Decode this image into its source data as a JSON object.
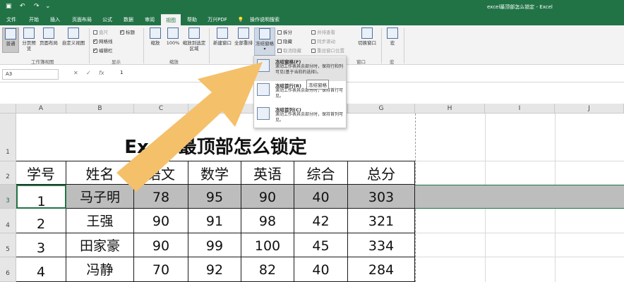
{
  "app": {
    "window_title": "excel最顶部怎么锁定 - Excel"
  },
  "menu_tabs": [
    "文件",
    "开始",
    "插入",
    "页面布局",
    "公式",
    "数据",
    "审阅",
    "视图",
    "帮助",
    "万兴PDF",
    "操作说明搜索"
  ],
  "ribbon": {
    "workbook_views": [
      "普通",
      "分页预览",
      "页面布局",
      "自定义视图"
    ],
    "workbook_views_group": "工作簿视图",
    "show_items": [
      {
        "label": "直尺",
        "checked": false,
        "enabled": false
      },
      {
        "label": "网格线",
        "checked": true,
        "enabled": true
      },
      {
        "label": "编辑栏",
        "checked": true,
        "enabled": true
      },
      {
        "label": "标题",
        "checked": true,
        "enabled": true
      }
    ],
    "show_group": "显示",
    "zoom_items": [
      "缩放",
      "100%",
      "缩放到选定区域"
    ],
    "zoom_group": "缩放",
    "window_items": [
      "新建窗口",
      "全部重排",
      "冻结窗格"
    ],
    "window_small": [
      "拆分",
      "隐藏",
      "取消隐藏"
    ],
    "window_small_dim": [
      "并排查看",
      "同步滚动",
      "重设窗口位置"
    ],
    "switch_window": "切换窗口",
    "window_group": "窗口",
    "macro": "宏",
    "macro_group": "宏"
  },
  "formula_bar": {
    "name_box": "A3",
    "fx": "fx",
    "value": "1"
  },
  "freeze_menu": {
    "items": [
      {
        "title": "冻结窗格(F)",
        "desc": "滚动工作表其余部分时，保持行和列可见(基于当前的选择)。"
      },
      {
        "title": "冻结首行(R)",
        "desc": "滚动工作表其余部分时，保持首行可见。"
      },
      {
        "title": "冻结首列(C)",
        "desc": "滚动工作表其余部分时，保持首列可见。"
      }
    ],
    "tooltip": "冻结窗格"
  },
  "grid": {
    "columns": [
      "A",
      "B",
      "C",
      "D",
      "E",
      "F",
      "G",
      "H",
      "I",
      "J"
    ],
    "rows": [
      "1",
      "2",
      "3",
      "4",
      "5",
      "6"
    ],
    "title": "Excel最顶部怎么锁定",
    "headers": [
      "学号",
      "姓名",
      "语文",
      "数学",
      "英语",
      "综合",
      "总分"
    ],
    "data": [
      [
        "1",
        "马子明",
        "78",
        "95",
        "90",
        "40",
        "303"
      ],
      [
        "2",
        "王强",
        "90",
        "91",
        "98",
        "42",
        "321"
      ],
      [
        "3",
        "田家豪",
        "90",
        "99",
        "100",
        "45",
        "334"
      ],
      [
        "4",
        "冯静",
        "70",
        "92",
        "82",
        "40",
        "284"
      ]
    ]
  },
  "colors": {
    "excel_green": "#217346",
    "arrow": "#f5c06a",
    "selected_row": "#bdbdbd"
  }
}
